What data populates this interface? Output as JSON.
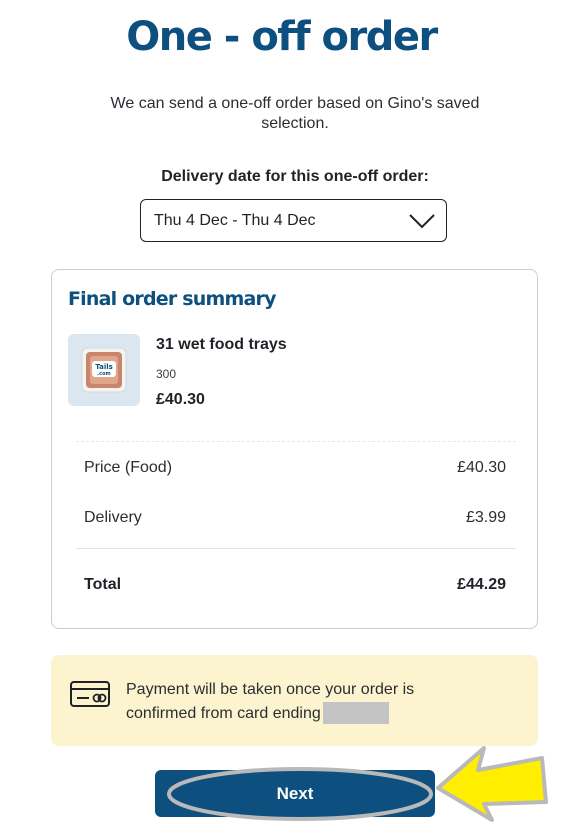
{
  "page": {
    "title": "One - off order",
    "intro": "We can send a one-off order based on Gino's saved selection."
  },
  "delivery": {
    "label": "Delivery date for this one-off order:",
    "selected": "Thu 4 Dec - Thu 4 Dec"
  },
  "summary": {
    "title": "Final order summary",
    "product": {
      "name": "31 wet food trays",
      "subtitle": "300",
      "price": "£40.30",
      "thumb_text_1": "Tails",
      "thumb_text_2": ".com",
      "icon": "food-tray-icon"
    },
    "rows": [
      {
        "label": "Price (Food)",
        "value": "£40.30"
      },
      {
        "label": "Delivery",
        "value": "£3.99"
      }
    ],
    "total": {
      "label": "Total",
      "value": "£44.29"
    }
  },
  "payment": {
    "text": "Payment will be taken once your order is confirmed from card ending",
    "icon": "credit-card-icon"
  },
  "actions": {
    "next_label": "Next"
  },
  "colors": {
    "brand": "#0d5080",
    "note_bg": "#fcf3cf",
    "highlight_arrow": "#ffee00"
  }
}
